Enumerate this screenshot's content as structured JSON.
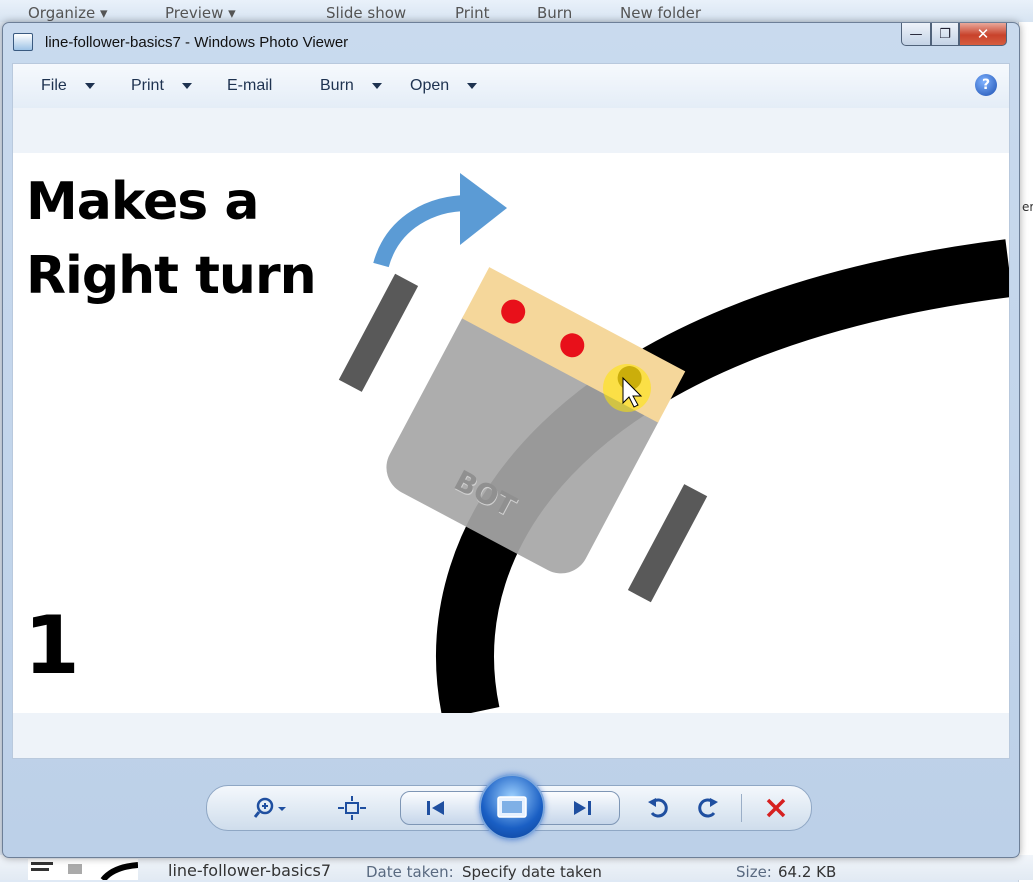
{
  "background": {
    "toolbar_items": [
      "Organize ▾",
      "Preview ▾",
      "Slide show",
      "Print",
      "Burn",
      "New folder"
    ],
    "right_fragment": "er-",
    "status": {
      "file_name": "line-follower-basics7",
      "date_label": "Date taken:",
      "date_value": "Specify date taken",
      "size_label": "Size:",
      "size_value": "64.2 KB"
    }
  },
  "window": {
    "title": "line-follower-basics7 - Windows Photo Viewer",
    "minimize_glyph": "—",
    "maximize_glyph": "❐",
    "close_glyph": "✕"
  },
  "menu": {
    "file": "File",
    "print": "Print",
    "email": "E-mail",
    "burn": "Burn",
    "open": "Open",
    "help": "?"
  },
  "photo": {
    "title_line1": "Makes a",
    "title_line2": "Right turn",
    "step_number": "1",
    "bot_label": "BOT"
  },
  "controls": {
    "icons": [
      "zoom-icon",
      "actual-size-icon",
      "previous-icon",
      "slideshow-icon",
      "next-icon",
      "rotate-counterclockwise-icon",
      "rotate-clockwise-icon",
      "delete-icon"
    ]
  },
  "colors": {
    "arrow": "#5b9bd5",
    "track": "#000000",
    "sensor_bar": "#f5d79b",
    "sensor_red": "#e8101a",
    "bot_body": "#a6a6a6",
    "wheel": "#595959",
    "delete": "#d62020"
  }
}
